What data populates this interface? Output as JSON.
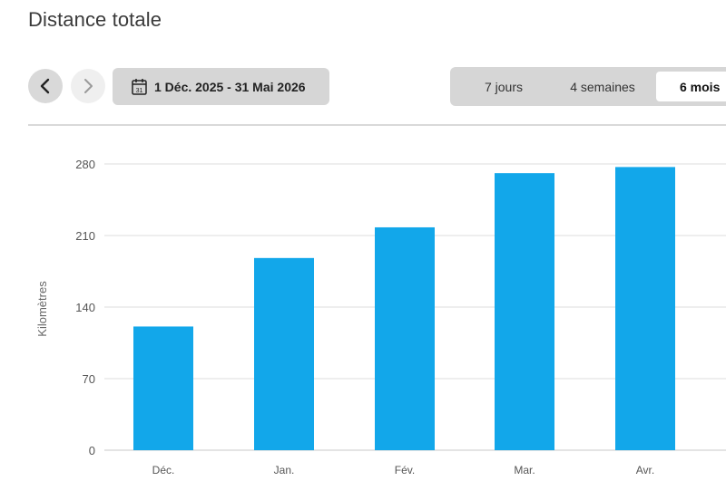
{
  "page": {
    "title": "Distance totale"
  },
  "nav": {
    "prev_icon": "chevron-left-icon",
    "next_icon": "chevron-right-icon"
  },
  "date_range": {
    "icon": "calendar-icon",
    "icon_day": "31",
    "label": "1 Déc. 2025 - 31 Mai 2026"
  },
  "period": {
    "options": [
      "7 jours",
      "4 semaines",
      "6 mois"
    ],
    "selected": "6 mois"
  },
  "colors": {
    "bar": "#12a7ea",
    "grid": "#dcdcdc",
    "axis": "#c8c8c8",
    "tick_text": "#555555"
  },
  "chart_data": {
    "type": "bar",
    "categories": [
      "Déc.",
      "Jan.",
      "Fév.",
      "Mar.",
      "Avr."
    ],
    "values": [
      121,
      188,
      218,
      271,
      277
    ],
    "ylabel": "Kilomètres",
    "yticks": [
      0,
      70,
      140,
      210,
      280
    ],
    "ylim": [
      0,
      280
    ],
    "grid": true
  }
}
